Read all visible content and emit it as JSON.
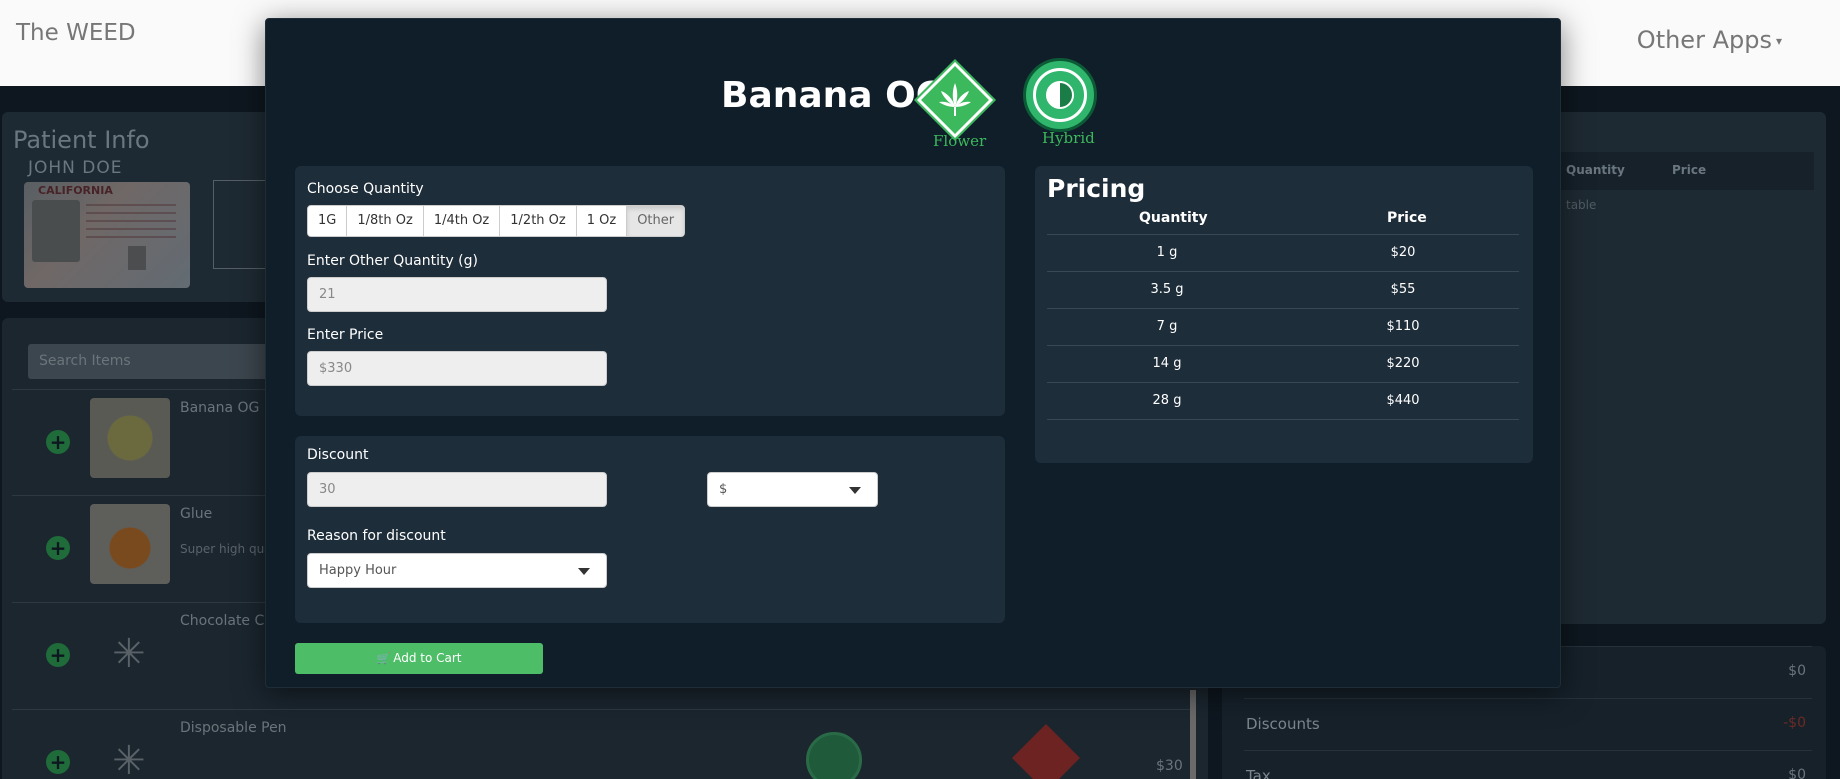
{
  "app": {
    "brand": "The WEED",
    "other_apps": "Other Apps"
  },
  "patient": {
    "title": "Patient Info",
    "name": "JOHN DOE",
    "license_state": "CALIFORNIA"
  },
  "search": {
    "placeholder": "Search Items"
  },
  "items": [
    {
      "name": "Banana OG",
      "desc": ""
    },
    {
      "name": "Glue",
      "desc": "Super high qual"
    },
    {
      "name": "Chocolate Co",
      "desc": ""
    },
    {
      "name": "Disposable Pen",
      "desc": "",
      "price": "$30"
    }
  ],
  "cart": {
    "col_quantity": "Quantity",
    "col_price": "Price",
    "empty_text": "table"
  },
  "totals": [
    {
      "label": "",
      "value": "$0"
    },
    {
      "label": "Discounts",
      "value": "-$0"
    },
    {
      "label": "Tax",
      "value": "$0"
    }
  ],
  "modal": {
    "title": "Banana OG",
    "type_badge": {
      "label": "Flower",
      "icon": "cannabis-leaf-icon",
      "color": "#3cb95c"
    },
    "strain_badge": {
      "label": "Hybrid",
      "icon": "hybrid-half-circle-icon",
      "color": "#2fb56c"
    },
    "quantity": {
      "label": "Choose Quantity",
      "options": [
        "1G",
        "1/8th Oz",
        "1/4th Oz",
        "1/2th Oz",
        "1 Oz",
        "Other"
      ],
      "selected": "Other"
    },
    "other_quantity": {
      "label": "Enter Other Quantity (g)",
      "value": "21"
    },
    "price": {
      "label": "Enter Price",
      "value": "$330"
    },
    "discount": {
      "label": "Discount",
      "value": "30",
      "unit": "$"
    },
    "reason": {
      "label": "Reason for discount",
      "value": "Happy Hour"
    },
    "add_to_cart": "Add to Cart",
    "pricing": {
      "title": "Pricing",
      "headers": [
        "Quantity",
        "Price"
      ],
      "rows": [
        [
          "1 g",
          "$20"
        ],
        [
          "3.5 g",
          "$55"
        ],
        [
          "7 g",
          "$110"
        ],
        [
          "14 g",
          "$220"
        ],
        [
          "28 g",
          "$440"
        ]
      ]
    }
  },
  "colors": {
    "accent_green": "#4ebd67",
    "modal_bg": "#101e29",
    "card_bg": "#1e2d3a"
  }
}
